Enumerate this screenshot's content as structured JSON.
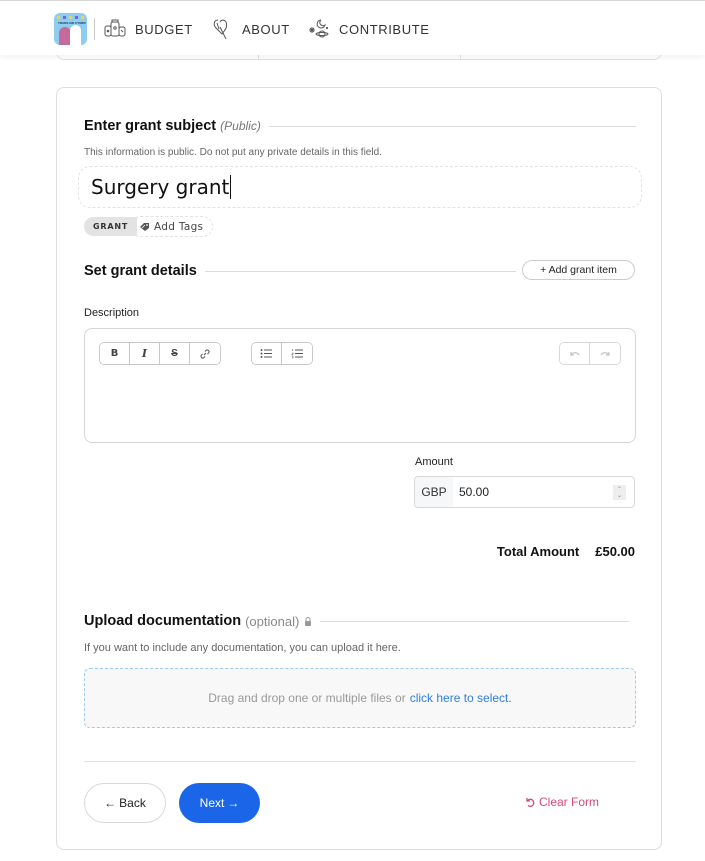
{
  "nav": {
    "logo_alt": "Trans Aid Cymru",
    "items": [
      {
        "label": "BUDGET",
        "icon": "jars-icon"
      },
      {
        "label": "ABOUT",
        "icon": "hand-heart-icon"
      },
      {
        "label": "CONTRIBUTE",
        "icon": "stars-planet-icon"
      }
    ]
  },
  "subject": {
    "title": "Enter grant subject",
    "hint": "(Public)",
    "help": "This information is public. Do not put any private details in this field.",
    "value": "Surgery grant",
    "tags": [
      {
        "label": "GRANT"
      }
    ],
    "add_tags_label": "Add Tags"
  },
  "details": {
    "title": "Set grant details",
    "add_item_label": "+ Add grant item",
    "description_label": "Description",
    "description_value": "",
    "toolbar": {
      "format": [
        {
          "label": "B",
          "icon": "bold-icon"
        },
        {
          "label": "I",
          "icon": "italic-icon"
        },
        {
          "label": "S",
          "icon": "strikethrough-icon"
        },
        {
          "label": "link",
          "icon": "link-icon"
        }
      ],
      "lists": [
        {
          "label": "bullet list",
          "icon": "bullet-list-icon"
        },
        {
          "label": "ordered list",
          "icon": "ordered-list-icon"
        }
      ],
      "history": [
        {
          "label": "undo",
          "icon": "undo-icon",
          "disabled": true
        },
        {
          "label": "redo",
          "icon": "redo-icon",
          "disabled": true
        }
      ]
    },
    "amount_label": "Amount",
    "currency": "GBP",
    "amount_value": "50.00",
    "total_label": "Total Amount",
    "total_value": "£50.00"
  },
  "upload": {
    "title": "Upload documentation",
    "hint": "(optional)",
    "help": "If you want to include any documentation, you can upload it here.",
    "drop_text": "Drag and drop one or multiple files or",
    "drop_link": "click here to select."
  },
  "actions": {
    "back_label": "Back",
    "next_label": "Next",
    "clear_label": "Clear Form"
  },
  "colors": {
    "primary": "#1b66e8",
    "danger": "#d9487a",
    "link": "#2f7fe0"
  }
}
